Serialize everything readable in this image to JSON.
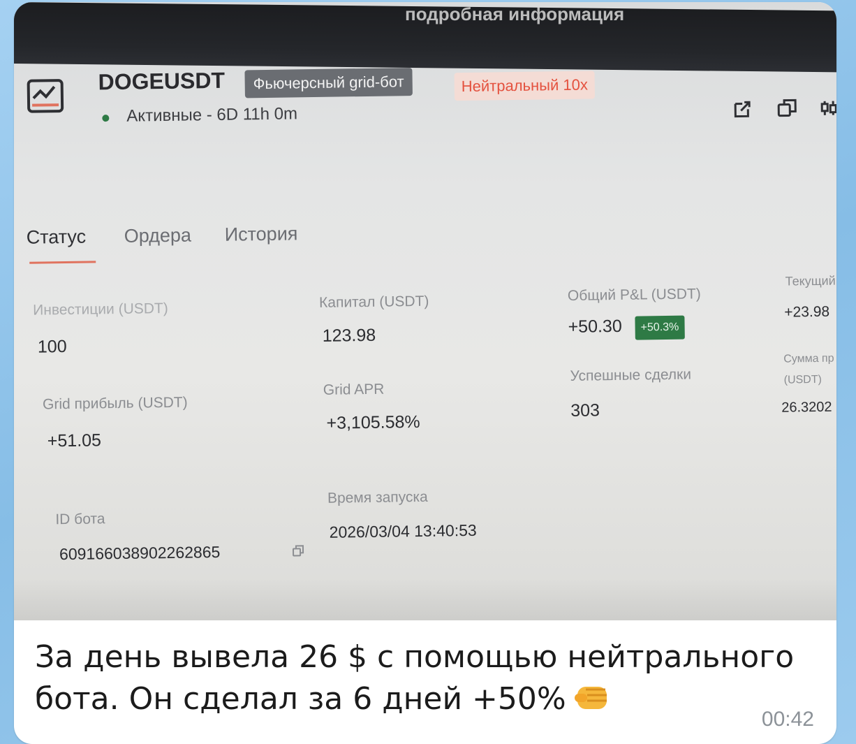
{
  "photo": {
    "top_text": "подробная информация",
    "bot": {
      "symbol": "DOGEUSDT",
      "type_tag": "Фьючерсный grid-бот",
      "mode_tag": "Нейтральный 10x",
      "status": "Активные - 6D 11h 0m",
      "status_color": "#2e7a45"
    },
    "tabs": [
      {
        "label": "Статус",
        "active": true
      },
      {
        "label": "Ордера",
        "active": false
      },
      {
        "label": "История",
        "active": false
      }
    ],
    "metrics": {
      "investment": {
        "label": "Инвестиции (USDT)",
        "value": "100"
      },
      "capital": {
        "label": "Капитал (USDT)",
        "value": "123.98"
      },
      "total_pnl": {
        "label": "Общий P&L (USDT)",
        "value": "+50.30",
        "badge": "+50.3%"
      },
      "current": {
        "label": "Текущий",
        "value": "+23.98"
      },
      "grid_profit": {
        "label": "Grid прибыль (USDT)",
        "value": "+51.05"
      },
      "grid_apr": {
        "label": "Grid APR",
        "value": "+3,105.58%"
      },
      "successful_trades": {
        "label": "Успешные сделки",
        "value": "303"
      },
      "sum": {
        "label_line1": "Сумма пр",
        "label_line2": "(USDT)",
        "value": "26.3202"
      },
      "bot_id": {
        "label": "ID бота",
        "value": "609166038902262865"
      },
      "launch_time": {
        "label": "Время запуска",
        "value": "2026/03/04 13:40:53"
      }
    },
    "accent_color": "#e0735f"
  },
  "message": {
    "text": "За день вывела 26 $ с помощью нейтрального бота. Он сделал за 6 дней +50%",
    "time": "00:42"
  }
}
